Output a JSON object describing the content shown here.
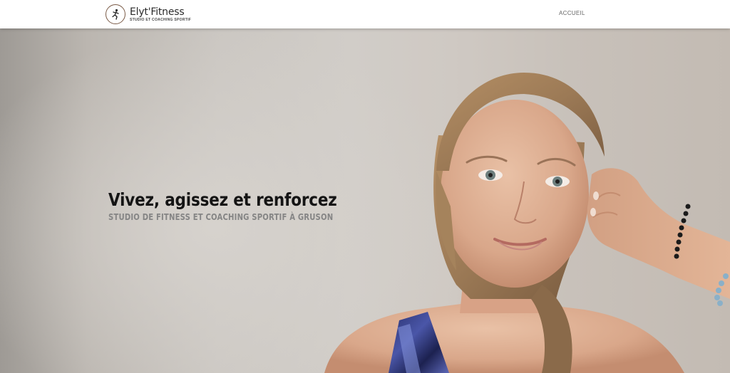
{
  "header": {
    "logo_icon": "runner-logo-icon",
    "brand_name": "Elyt'Fitness",
    "tagline": "STUDIO ET COACHING SPORTIF",
    "nav": [
      {
        "label": "ACCUEIL"
      }
    ]
  },
  "hero": {
    "title": "Vivez, agissez et renforcez",
    "subtitle": "STUDIO DE FITNESS ET COACHING SPORTIF À GRUSON",
    "image": "woman-portrait-photo"
  },
  "colors": {
    "header_bg": "#ffffff",
    "logo_accent": "#7a5a46",
    "title": "#141414",
    "subtitle": "#858585",
    "nav_text": "#666666"
  }
}
